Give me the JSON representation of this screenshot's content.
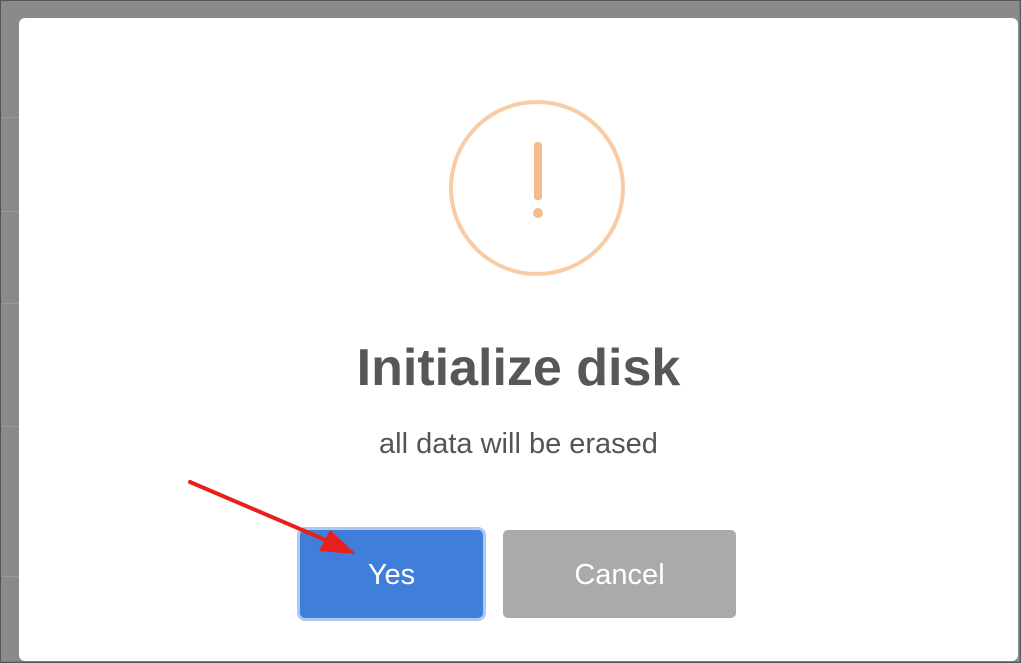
{
  "dialog": {
    "title": "Initialize disk",
    "message": "all data will be erased",
    "confirm_label": "Yes",
    "cancel_label": "Cancel",
    "icon": "warning-exclamation-icon"
  },
  "colors": {
    "confirm_button": "#3f7fd9",
    "cancel_button": "#aaaaaa",
    "warning_icon": "#f8cda6",
    "annotation_arrow": "#e8201c"
  },
  "annotation": {
    "icon": "red-arrow-annotation",
    "points_to": "Yes"
  }
}
